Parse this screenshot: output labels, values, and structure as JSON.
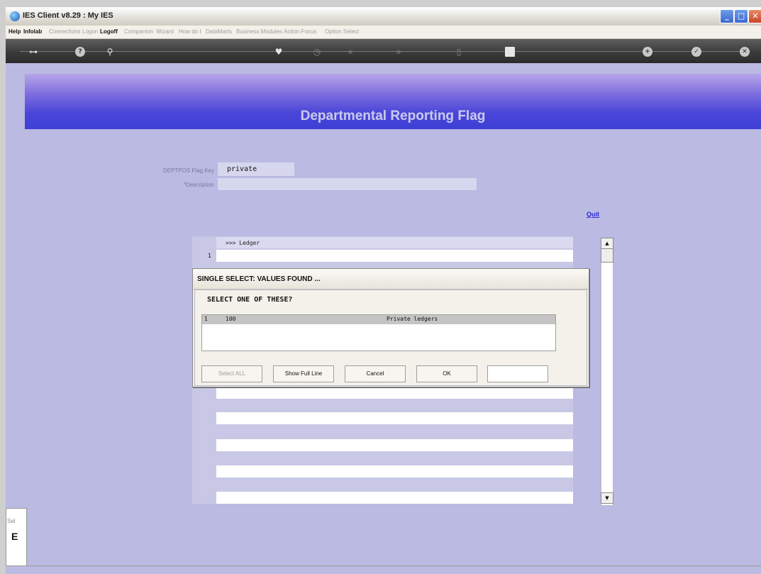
{
  "window": {
    "title": "IES Client v8.29 : My IES",
    "min_glyph": "_",
    "max_glyph": "□",
    "close_glyph": "✕"
  },
  "menubar": {
    "items": [
      {
        "label": "Help",
        "active": true
      },
      {
        "label": "Infolab",
        "active": true
      },
      {
        "label": "Connections",
        "active": false
      },
      {
        "label": "Logon",
        "active": false
      },
      {
        "label": "Logoff",
        "active": true
      },
      {
        "label": "Companion",
        "active": false
      },
      {
        "label": "Wizard",
        "active": false
      },
      {
        "label": "How do I",
        "active": false
      },
      {
        "label": "DataMarts",
        "active": false
      },
      {
        "label": "Business Modules",
        "active": false
      },
      {
        "label": "Action Focus",
        "active": false
      },
      {
        "label": "Option Select",
        "active": false
      }
    ]
  },
  "toolbar": {
    "icons": [
      {
        "name": "key-icon",
        "glyph": "⊶"
      },
      {
        "name": "help-icon",
        "glyph": "?"
      },
      {
        "name": "search-icon",
        "glyph": "⚲"
      },
      {
        "name": "heart-icon",
        "glyph": "♥"
      },
      {
        "name": "clock-icon",
        "glyph": "◷"
      },
      {
        "name": "rewind-icon",
        "glyph": "«"
      },
      {
        "name": "forward-icon",
        "glyph": "»"
      },
      {
        "name": "document-icon",
        "glyph": "▯"
      },
      {
        "name": "stop-icon",
        "glyph": "■"
      },
      {
        "name": "add-icon",
        "glyph": "+"
      },
      {
        "name": "check-icon",
        "glyph": "✓"
      },
      {
        "name": "cancel-icon",
        "glyph": "✕"
      }
    ]
  },
  "page": {
    "title": "Departmental Reporting Flag"
  },
  "form": {
    "flag_key_label": "DEPTPOS Flag Key",
    "flag_key_value": "private",
    "description_label": "*Description",
    "description_value": ""
  },
  "quit_label": "Quit",
  "grid": {
    "header": ">>> Ledger",
    "first_row_number": "1"
  },
  "dialog": {
    "title": "SINGLE SELECT: VALUES FOUND ...",
    "prompt": "SELECT ONE OF THESE?",
    "results": [
      {
        "index": "1",
        "code": "100",
        "description": "Private ledgers"
      }
    ],
    "buttons": {
      "select_all": "Select ALL",
      "show_full_line": "Show Full Line",
      "cancel": "Cancel",
      "ok": "OK"
    },
    "filter_value": ""
  },
  "status": {
    "line1": "Sel",
    "line2": "E"
  },
  "colors": {
    "background": "#babae3",
    "header_band": "#4b46d8",
    "quit_link": "#2b2bd3"
  }
}
